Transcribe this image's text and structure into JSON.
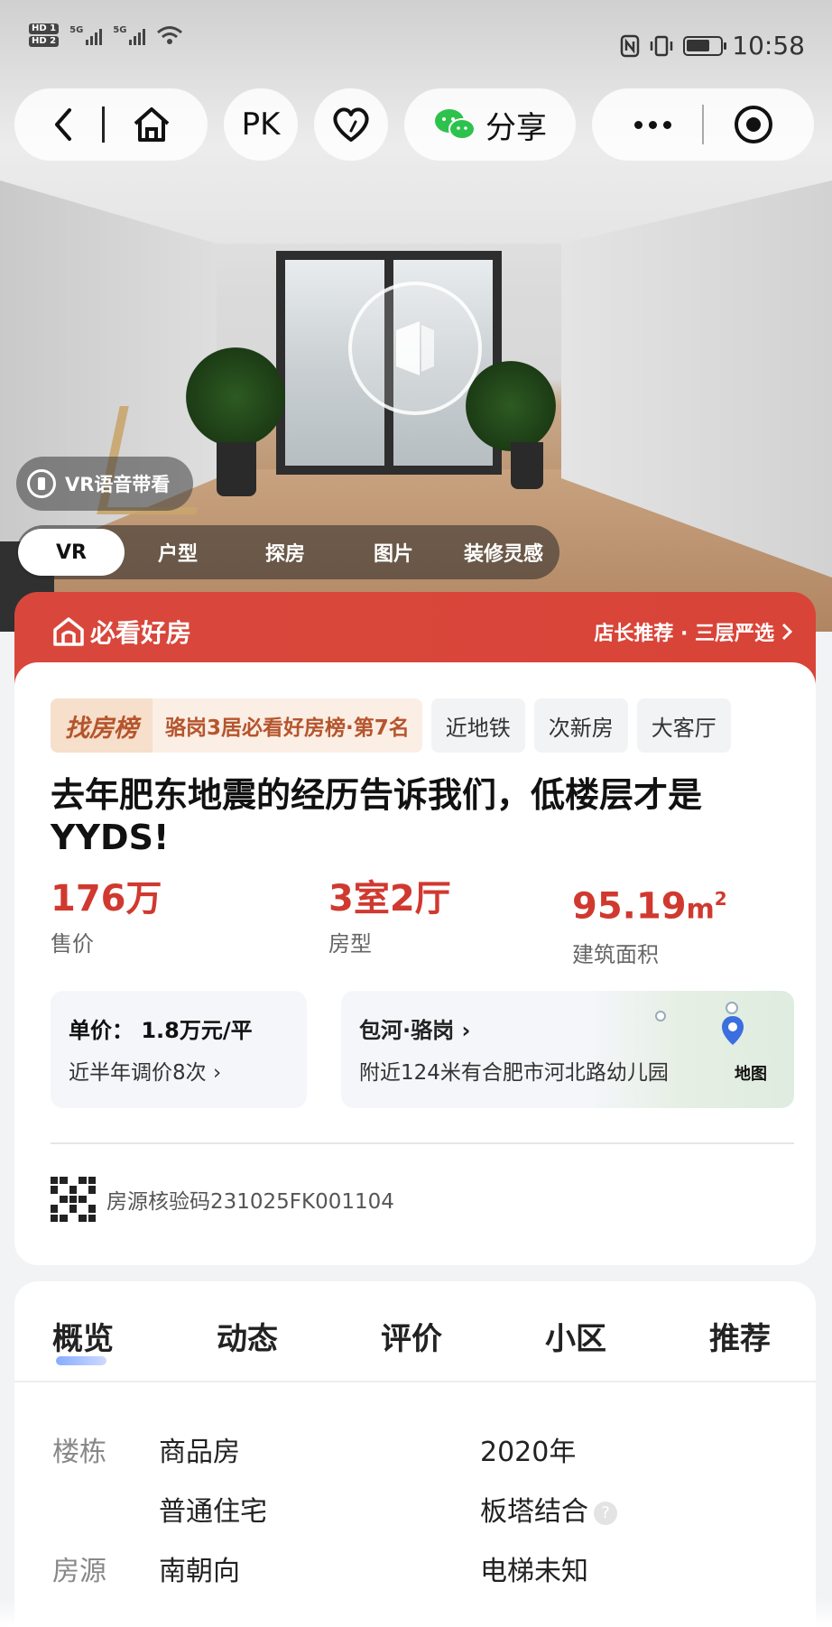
{
  "status_bar": {
    "hd1": "HD 1",
    "hd2": "HD 2",
    "net1": "5G",
    "net2": "5G",
    "time": "10:58",
    "battery_level": 0.7
  },
  "top_bar": {
    "pk_label": "PK",
    "share_label": "分享"
  },
  "media": {
    "voice_guide_label": "VR语音带看",
    "tabs": [
      "VR",
      "户型",
      "探房",
      "图片",
      "装修灵感"
    ]
  },
  "banner": {
    "title": "必看好房",
    "right_text": "店长推荐 · 三层严选"
  },
  "listing": {
    "rank_badge": "找房榜",
    "rank_text": "骆岗3居必看好房榜·第7名",
    "tags": [
      "近地铁",
      "次新房",
      "大客厅"
    ],
    "title": "去年肥东地震的经历告诉我们，低楼层才是YYDS!",
    "price_value": "176万",
    "price_label": "售价",
    "layout_value": "3室2厅",
    "layout_label": "房型",
    "area_value": "95.19",
    "area_unit": "m",
    "area_sup": "2",
    "area_label": "建筑面积",
    "unit_price": "单价： 1.8万元/平",
    "price_changes": "近半年调价8次",
    "district": "包河·骆岗",
    "nearby": "附近124米有合肥市河北路幼儿园",
    "map_label": "地图",
    "verify_code": "房源核验码231025FK001104"
  },
  "info": {
    "tabs": [
      "概览",
      "动态",
      "评价",
      "小区",
      "推荐"
    ],
    "building_label": "楼栋",
    "source_label": "房源",
    "row1_left": "商品房",
    "row1_right": "2020年",
    "row2_left": "普通住宅",
    "row2_right": "板塔结合",
    "row3_left": "南朝向",
    "row3_right": "电梯未知",
    "help_glyph": "?"
  },
  "colors": {
    "accent_red": "#d9473c",
    "price_red": "#d0392f",
    "rank_orange": "#b5552d"
  }
}
